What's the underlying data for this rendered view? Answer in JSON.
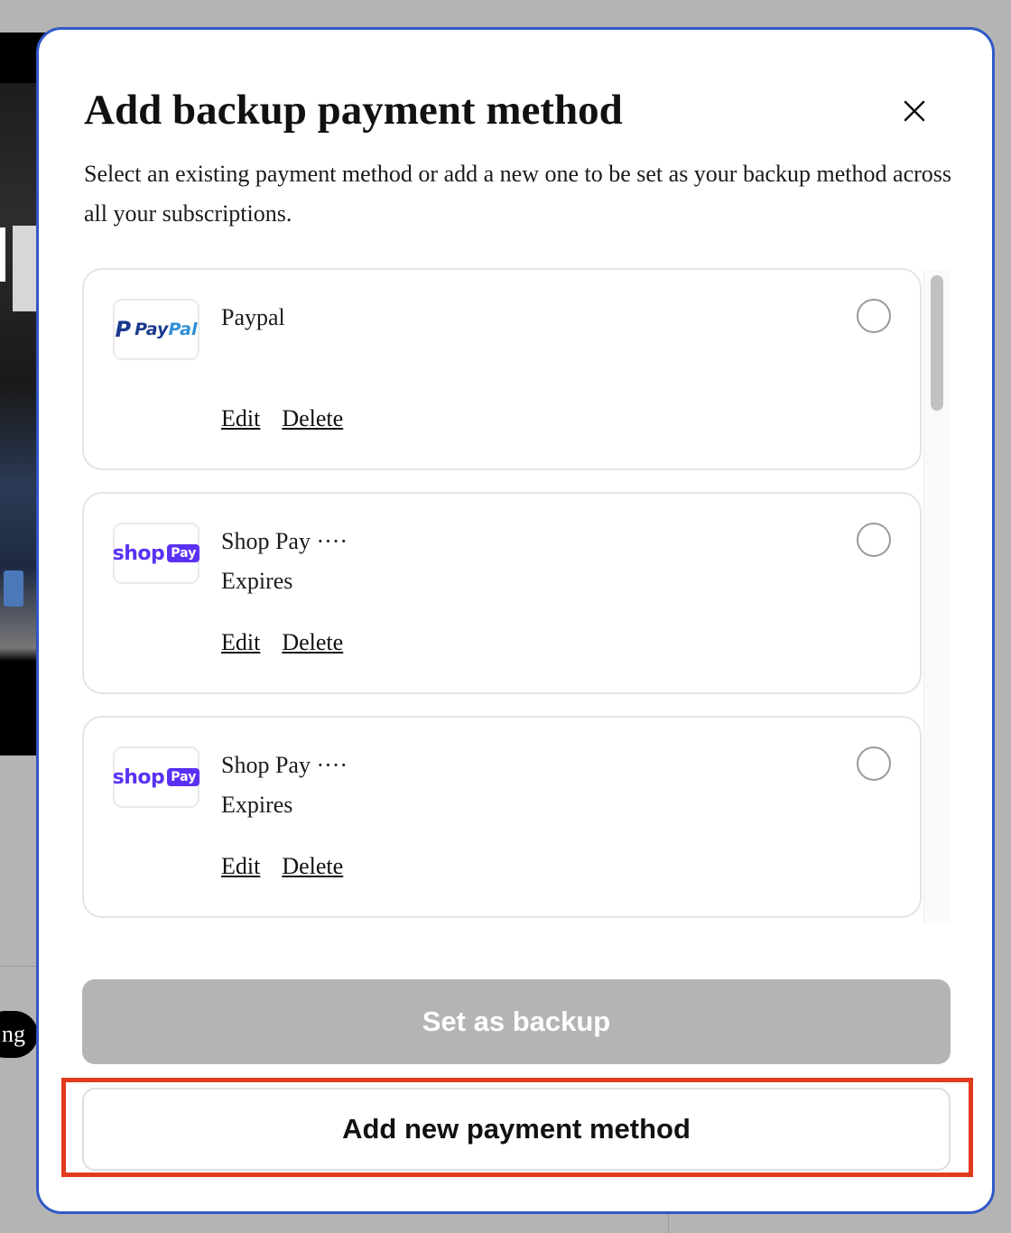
{
  "background": {
    "pill_text": "ng"
  },
  "modal": {
    "title": "Add backup payment method",
    "description": "Select an existing payment method or add a new one to be set as your backup method across all your subscriptions.",
    "close_icon": "close-icon"
  },
  "payment_methods": [
    {
      "logo": "paypal-logo",
      "logo_text": "PayPal",
      "name": "Paypal",
      "expires": "",
      "edit_label": "Edit",
      "delete_label": "Delete",
      "selected": false
    },
    {
      "logo": "shop-pay-logo",
      "logo_text": "shop Pay",
      "name": "Shop Pay ····",
      "expires": "Expires",
      "edit_label": "Edit",
      "delete_label": "Delete",
      "selected": false
    },
    {
      "logo": "shop-pay-logo",
      "logo_text": "shop Pay",
      "name": "Shop Pay ····",
      "expires": "Expires",
      "edit_label": "Edit",
      "delete_label": "Delete",
      "selected": false
    }
  ],
  "actions": {
    "set_backup_label": "Set as backup",
    "add_new_label": "Add new payment method"
  },
  "colors": {
    "modal_border": "#2f59c7",
    "highlight": "#e23a1c",
    "disabled_button": "#b4b4b4",
    "shop_pay_purple": "#5a31f4",
    "paypal_blue": "#1b3a8e"
  }
}
